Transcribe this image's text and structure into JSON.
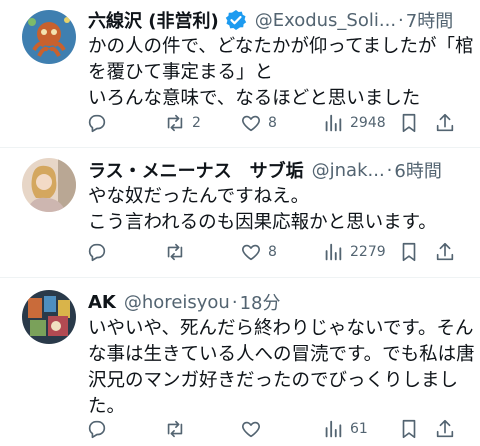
{
  "posts": [
    {
      "name": "六線沢 (非営利)",
      "verified": true,
      "handle": "@Exodus_Soli...",
      "dot": "·",
      "time": "7時間",
      "lines": [
        "かの人の件で、どなたかが仰ってましたが「棺",
        "を覆ひて事定まる」と",
        "いろんな意味で、なるほどと思いました"
      ],
      "replies": "",
      "reposts": "2",
      "likes": "8",
      "views": "2948"
    },
    {
      "name": "ラス・メニーナス　サブ垢",
      "verified": false,
      "handle": "@jnak...",
      "dot": "·",
      "time": "6時間",
      "lines": [
        "やな奴だったんですねえ。",
        "こう言われるのも因果応報かと思います。"
      ],
      "replies": "",
      "reposts": "",
      "likes": "8",
      "views": "2279"
    },
    {
      "name": "AK",
      "verified": false,
      "handle": "@horeisyou",
      "dot": "·",
      "time": "18分",
      "lines": [
        "いやいや、死んだら終わりじゃないです。そん",
        "な事は生きている人への冒涜です。でも私は唐",
        "沢兄のマンガ好きだったのでびっくりしまし",
        "た。"
      ],
      "replies": "",
      "reposts": "",
      "likes": "",
      "views": "61"
    }
  ],
  "colors": {
    "text": "#0f1419",
    "secondary": "#536471",
    "verified": "#1d9bf0",
    "divider": "#eff3f4"
  },
  "icons": [
    "reply-icon",
    "repost-icon",
    "like-icon",
    "views-icon",
    "bookmark-icon",
    "share-icon"
  ]
}
